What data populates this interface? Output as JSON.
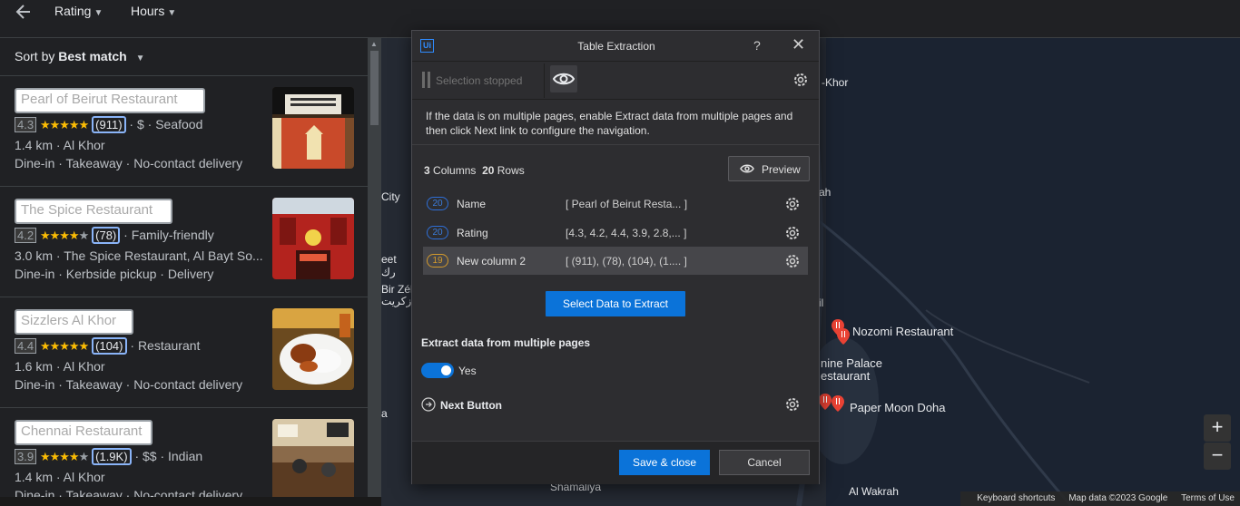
{
  "topbar": {
    "filters": [
      "Rating",
      "Hours"
    ]
  },
  "sort": {
    "prefix": "Sort by",
    "value": "Best match"
  },
  "results": [
    {
      "name": "Pearl of Beirut Restaurant",
      "rating": "4.3",
      "stars": 4.5,
      "count": "(911)",
      "meta": "· $ · Seafood",
      "line2": "1.4 km · Al Khor",
      "line3": "Dine-in · Takeaway · No-contact delivery"
    },
    {
      "name": "The Spice Restaurant",
      "rating": "4.2",
      "stars": 4,
      "count": "(78)",
      "meta": "· Family-friendly",
      "line2": "3.0 km · The Spice Restaurant, Al Bayt So...",
      "line3": "Dine-in · Kerbside pickup · Delivery"
    },
    {
      "name": "Sizzlers Al Khor",
      "rating": "4.4",
      "stars": 4.5,
      "count": "(104)",
      "meta": "· Restaurant",
      "line2": "1.6 km · Al Khor",
      "line3": "Dine-in · Takeaway · No-contact delivery"
    },
    {
      "name": "Chennai Restaurant",
      "rating": "3.9",
      "stars": 4,
      "count": "(1.9K)",
      "meta": "· $$ · Indian",
      "line2": "1.4 km · Al Khor",
      "line3": "Dine-in · Takeaway · No-contact delivery"
    }
  ],
  "map": {
    "labels": {
      "al_khor": "-Khor",
      "city": "City",
      "bir_zek": "Bir Zék",
      "bir_zek_ar": "بئر زكريت",
      "eet": "eet",
      "eet_ar": "رك",
      "ah": "ah",
      "nozomi": "Nozomi Restaurant",
      "nine_palace": "nine Palace",
      "estaurant": "estaurant",
      "paper_moon": "Paper Moon Doha",
      "shamaliya": "Shamaliya",
      "al_wakrah": "Al Wakrah",
      "il": "il",
      "a": "a"
    },
    "zoom_in": "+",
    "zoom_out": "−",
    "footer": [
      "Keyboard shortcuts",
      "Map data ©2023 Google",
      "Terms of Use"
    ]
  },
  "dialog": {
    "logo": "Ui",
    "title": "Table Extraction",
    "help": "?",
    "close": "✕",
    "selection_status": "Selection stopped",
    "info": "If the data is on multiple pages, enable Extract data from multiple pages and then click Next link to configure the navigation.",
    "columns_count": "3",
    "columns_label": "Columns",
    "rows_count": "20",
    "rows_label": "Rows",
    "preview": "Preview",
    "columns": [
      {
        "badge": "20",
        "name": "Name",
        "preview": "[ Pearl of Beirut Resta... ]",
        "warn": false
      },
      {
        "badge": "20",
        "name": "Rating",
        "preview": "[4.3, 4.2, 4.4, 3.9, 2.8,... ]",
        "warn": false
      },
      {
        "badge": "19",
        "name": "New column 2",
        "preview": "[ (911), (78), (104), (1.... ]",
        "warn": true
      }
    ],
    "select_data": "Select Data to Extract",
    "multi_pages_heading": "Extract data from multiple pages",
    "toggle_label": "Yes",
    "next_button": "Next Button",
    "save": "Save & close",
    "cancel": "Cancel"
  },
  "colors": {
    "accent": "#0b73d9",
    "star": "#fbbc04",
    "warn": "#d39a2c",
    "pin": "#ea4335"
  }
}
